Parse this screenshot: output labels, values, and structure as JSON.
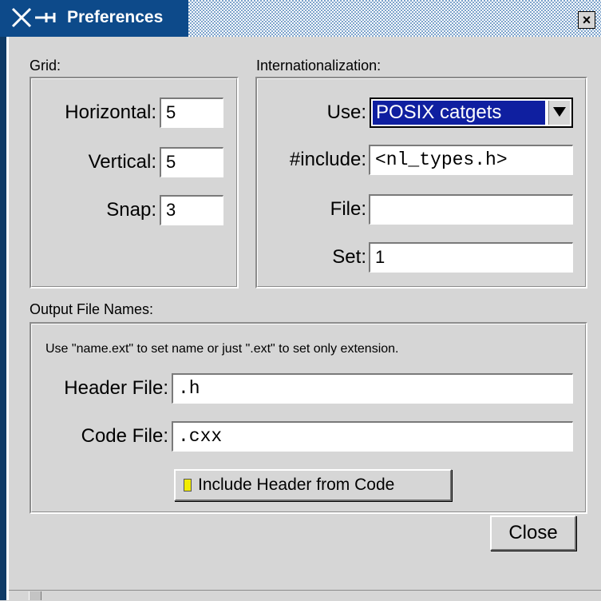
{
  "window": {
    "title": "Preferences",
    "close_glyph": "×"
  },
  "grid": {
    "label": "Grid:",
    "horizontal_label": "Horizontal:",
    "horizontal_value": "5",
    "vertical_label": "Vertical:",
    "vertical_value": "5",
    "snap_label": "Snap:",
    "snap_value": "3"
  },
  "i18n": {
    "label": "Internationalization:",
    "use_label": "Use:",
    "use_value": "POSIX catgets",
    "include_label": "#include:",
    "include_value": "<nl_types.h>",
    "file_label": "File:",
    "file_value": "",
    "set_label": "Set:",
    "set_value": "1"
  },
  "output": {
    "label": "Output File Names:",
    "hint": "Use \"name.ext\" to set name or just \".ext\" to set only extension.",
    "header_label": "Header File:",
    "header_value": ".h",
    "code_label": "Code File:",
    "code_value": ".cxx",
    "include_header_label": "Include Header from Code"
  },
  "actions": {
    "close_label": "Close"
  },
  "colors": {
    "title_bg": "#0d4a8a",
    "selection": "#0f1fa0",
    "checkbox_on": "#f2ec00",
    "panel": "#d6d6d6"
  },
  "icons": {
    "window_menu": "x-pin-icon",
    "window_close": "close-icon",
    "dropdown": "dropdown-arrow-icon"
  }
}
